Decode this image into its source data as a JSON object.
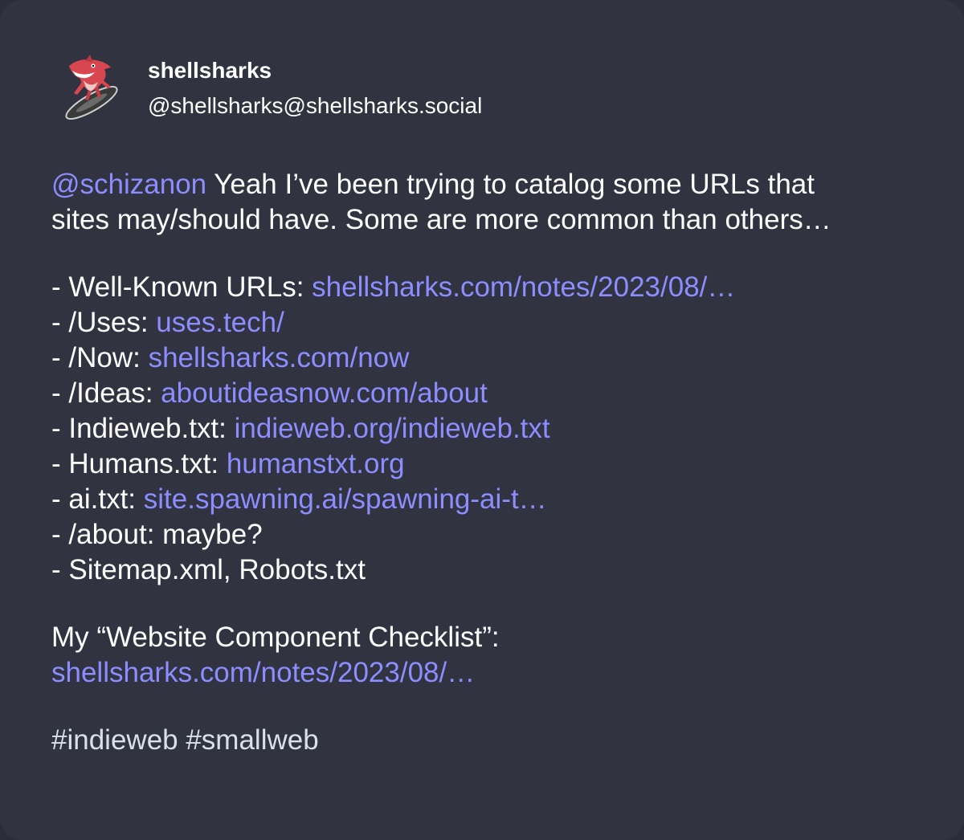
{
  "author": {
    "display_name": "shellsharks",
    "handle": "@shellsharks@shellsharks.social",
    "avatar_icon": "shark-avatar-icon"
  },
  "post": {
    "intro": {
      "mention": "@schizanon",
      "line1_text": " Yeah I’ve been trying to catalog some URLs that",
      "line2_text": "sites may/should have. Some are more common than others…"
    },
    "list": [
      {
        "label": "- Well-Known URLs: ",
        "link": "shellsharks.com/notes/2023/08/…"
      },
      {
        "label": "- /Uses: ",
        "link": "uses.tech/"
      },
      {
        "label": "- /Now: ",
        "link": "shellsharks.com/now"
      },
      {
        "label": "- /Ideas: ",
        "link": "aboutideasnow.com/about"
      },
      {
        "label": "- Indieweb.txt: ",
        "link": "indieweb.org/indieweb.txt"
      },
      {
        "label": "- Humans.txt: ",
        "link": "humanstxt.org"
      },
      {
        "label": "- ai.txt: ",
        "link": "site.spawning.ai/spawning-ai-t…"
      },
      {
        "label": "- /about: maybe?",
        "link": ""
      },
      {
        "label": "- Sitemap.xml, Robots.txt",
        "link": ""
      }
    ],
    "checklist": {
      "label": "My “Website Component Checklist”:",
      "link": "shellsharks.com/notes/2023/08/…"
    },
    "hashtags": "#indieweb #smallweb"
  },
  "colors": {
    "background": "#313340",
    "link": "#8c8dff",
    "text": "#ffffff",
    "hashtag": "#d9e1e8"
  }
}
